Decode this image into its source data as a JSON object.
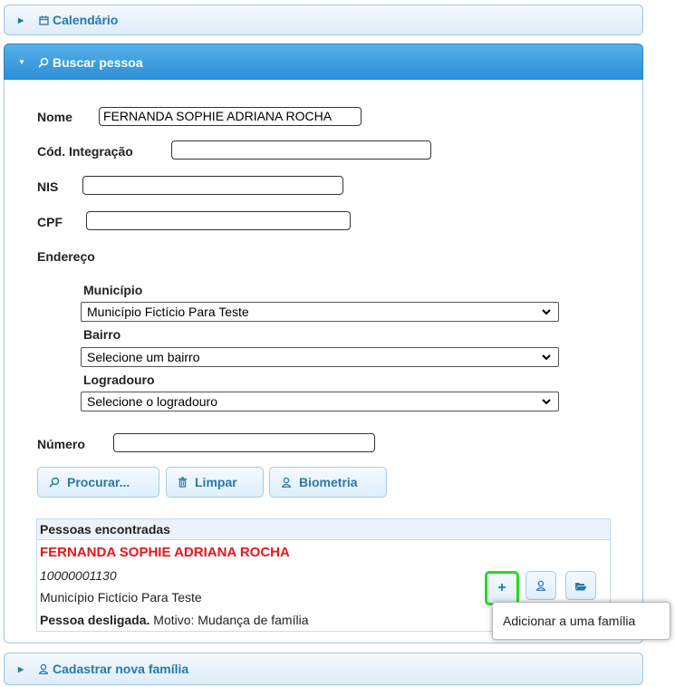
{
  "accordion": {
    "calendario_label": "Calendário",
    "buscar_label": "Buscar pessoa",
    "cadastrar_label": "Cadastrar nova família"
  },
  "form": {
    "nome_label": "Nome",
    "nome_value": "FERNANDA SOPHIE ADRIANA ROCHA",
    "cod_label": "Cód. Integração",
    "cod_value": "",
    "nis_label": "NIS",
    "nis_value": "",
    "cpf_label": "CPF",
    "cpf_value": "",
    "endereco_label": "Endereço",
    "municipio_label": "Município",
    "municipio_value": "Município Fictício Para Teste",
    "bairro_label": "Bairro",
    "bairro_value": "Selecione um bairro",
    "logradouro_label": "Logradouro",
    "logradouro_value": "Selecione o logradouro",
    "numero_label": "Número",
    "numero_value": ""
  },
  "buttons": {
    "procurar": "Procurar...",
    "limpar": "Limpar",
    "biometria": "Biometria"
  },
  "results": {
    "header": "Pessoas encontradas",
    "person": {
      "name": "FERNANDA SOPHIE ADRIANA ROCHA",
      "code": "10000001130",
      "municipio": "Município Fictício Para Teste",
      "status_bold": "Pessoa desligada.",
      "status_rest": "Motivo: Mudança de família"
    },
    "add_symbol": "+"
  },
  "tooltip": "Adicionar a uma família",
  "colors": {
    "accent": "#2779aa",
    "header_active": "#3a9ee0",
    "person_name": "#e8141c",
    "focus_outline": "#22dd22"
  },
  "icons": [
    "triangle-right-icon",
    "triangle-down-icon",
    "calendar-icon",
    "search-icon",
    "trash-icon",
    "person-icon",
    "folder-open-icon",
    "chevron-down-icon",
    "plus-icon"
  ]
}
